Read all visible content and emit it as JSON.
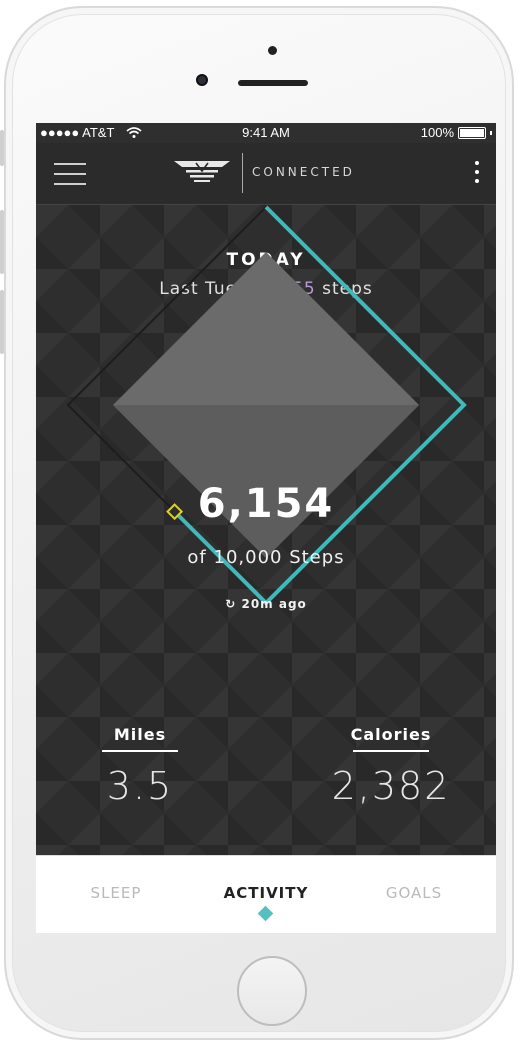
{
  "status_bar": {
    "carrier": "●●●●● AT&T",
    "time": "9:41 AM",
    "battery": "100%"
  },
  "header": {
    "brand": "CONNECTED"
  },
  "summary": {
    "title": "TODAY",
    "last_prefix": "Last Tue: ",
    "last_steps": "11,455",
    "last_suffix": " steps"
  },
  "steps": {
    "count": "6,154",
    "goal_text": "of 10,000 Steps",
    "sync_icon": "↻",
    "sync_text": "20m ago",
    "progress_fraction": 0.6154
  },
  "stats": {
    "miles_label": "Miles",
    "miles_value": "3.5",
    "calories_label": "Calories",
    "calories_value": "2,382"
  },
  "tabs": [
    {
      "label": "SLEEP"
    },
    {
      "label": "ACTIVITY"
    },
    {
      "label": "GOALS"
    }
  ],
  "colors": {
    "accent": "#3fb9bb",
    "highlight": "#b79ad6",
    "marker": "#e5d400"
  }
}
